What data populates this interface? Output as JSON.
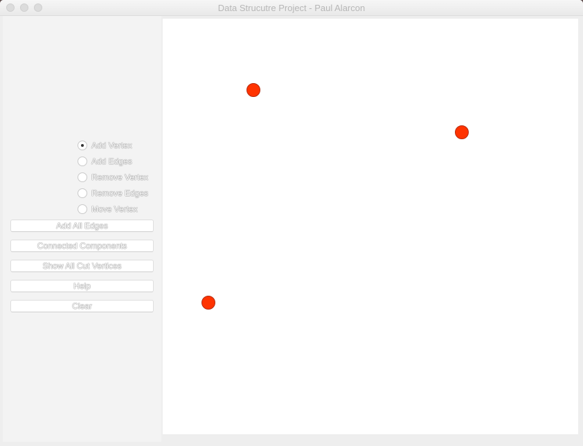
{
  "window": {
    "title": "Data Strucutre Project - Paul Alarcon"
  },
  "modes": {
    "selected": "Add Vertex",
    "items": [
      {
        "label": "Add Vertex",
        "checked": true
      },
      {
        "label": "Add Edges",
        "checked": false
      },
      {
        "label": "Remove Vertex",
        "checked": false
      },
      {
        "label": "Remove Edges",
        "checked": false
      },
      {
        "label": "Move Vertex",
        "checked": false
      }
    ]
  },
  "buttons": {
    "add_all_edges": "Add All Edges",
    "connected_components": "Connected Components",
    "show_all_cut_vertices": "Show All Cut Vertices",
    "help": "Help",
    "clear": "Clear"
  },
  "colors": {
    "vertex_fill": "#ff3300",
    "canvas_background": "#ffffff",
    "sidebar_background": "#f3f3f3"
  },
  "graph": {
    "vertex_count": 3,
    "edge_count": 0
  }
}
